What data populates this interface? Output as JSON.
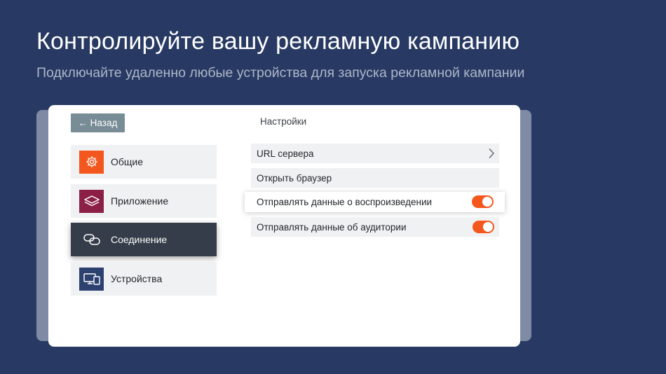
{
  "header": {
    "title": "Контролируйте вашу рекламную кампанию",
    "subtitle": "Подключайте удаленно любые устройства для запуска рекламной кампании"
  },
  "settings": {
    "back_label": "Назад",
    "title": "Настройки",
    "sidebar": {
      "items": [
        {
          "label": "Общие",
          "icon": "gear-icon",
          "icon_bg": "#f4571d",
          "active": false
        },
        {
          "label": "Приложение",
          "icon": "layers-icon",
          "icon_bg": "#8b1f45",
          "active": false
        },
        {
          "label": "Соединение",
          "icon": "link-icon",
          "icon_bg": "#343d49",
          "active": true
        },
        {
          "label": "Устройства",
          "icon": "devices-icon",
          "icon_bg": "#2c4170",
          "active": false
        }
      ]
    },
    "rows": [
      {
        "label": "URL сервера",
        "control": "chevron-right-icon"
      },
      {
        "label": "Открыть браузер",
        "control": "none"
      },
      {
        "label": "Отправлять данные о воспроизведении",
        "control": "toggle",
        "on": true
      },
      {
        "label": "Отправлять данные об аудитории",
        "control": "toggle",
        "on": true
      }
    ]
  },
  "colors": {
    "background": "#283a63",
    "accent": "#f4571d",
    "active_item": "#343d49"
  }
}
